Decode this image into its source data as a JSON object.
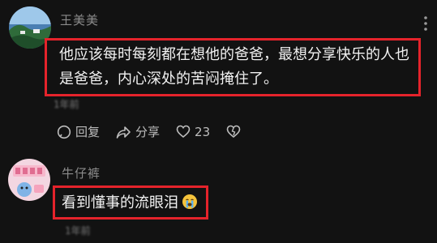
{
  "comment1": {
    "username": "王美美",
    "text": "他应该每时每刻都在想他的爸爸，最想分享快乐的人也是爸爸，内心深处的苦闷掩住了。",
    "blurred_note": "1年前"
  },
  "actions": {
    "reply_label": "回复",
    "share_label": "分享",
    "like_count": "23"
  },
  "comment2": {
    "username": "牛仔裤",
    "text": "看到懂事的流眼泪",
    "blurred_note": "1年前"
  },
  "colors": {
    "highlight": "#e5232b",
    "background": "#121212"
  },
  "icons": [
    "reply-icon",
    "share-icon",
    "heart-icon",
    "dislike-icon",
    "more-icon",
    "crying-emoji"
  ]
}
